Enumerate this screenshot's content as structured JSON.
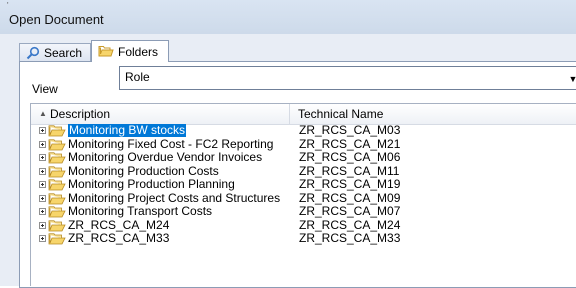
{
  "window": {
    "title": "Open Document"
  },
  "tabs": [
    {
      "label": "Search",
      "icon": "search-icon"
    },
    {
      "label": "Folders",
      "icon": "folder-icon"
    }
  ],
  "view": {
    "label": "View",
    "selected": "Role"
  },
  "table": {
    "columns": {
      "description": "Description",
      "technical_name": "Technical Name"
    },
    "rows": [
      {
        "description": "Monitoring BW stocks",
        "technical_name": "ZR_RCS_CA_M03",
        "selected": true
      },
      {
        "description": "Monitoring Fixed Cost  - FC2 Reporting",
        "technical_name": "ZR_RCS_CA_M21"
      },
      {
        "description": "Monitoring Overdue Vendor Invoices",
        "technical_name": "ZR_RCS_CA_M06"
      },
      {
        "description": "Monitoring Production Costs",
        "technical_name": "ZR_RCS_CA_M11"
      },
      {
        "description": "Monitoring Production Planning",
        "technical_name": "ZR_RCS_CA_M19"
      },
      {
        "description": "Monitoring Project Costs and Structures",
        "technical_name": "ZR_RCS_CA_M09"
      },
      {
        "description": "Monitoring Transport Costs",
        "technical_name": "ZR_RCS_CA_M07"
      },
      {
        "description": "ZR_RCS_CA_M24",
        "technical_name": "ZR_RCS_CA_M24"
      },
      {
        "description": "ZR_RCS_CA_M33",
        "technical_name": "ZR_RCS_CA_M33"
      }
    ]
  },
  "colors": {
    "selection": "#0078d7",
    "folder": "#f3c850",
    "window_bg": "#e8edf5"
  }
}
